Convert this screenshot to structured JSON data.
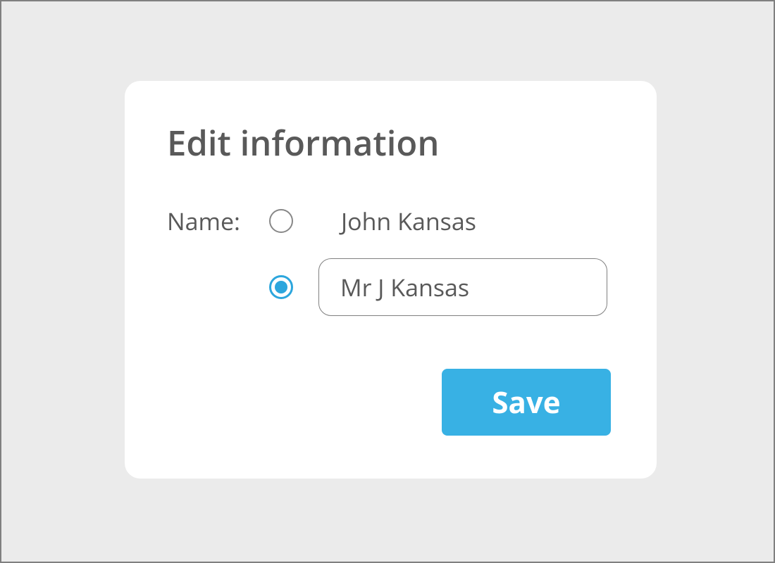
{
  "card": {
    "title": "Edit information",
    "name_label": "Name:",
    "option1_value": "John Kansas",
    "option2_value": "Mr J Kansas",
    "save_label": "Save"
  }
}
